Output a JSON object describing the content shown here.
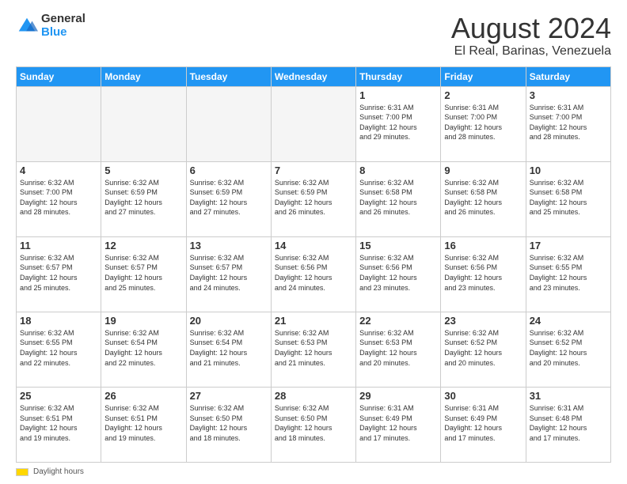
{
  "logo": {
    "general": "General",
    "blue": "Blue"
  },
  "title": "August 2024",
  "subtitle": "El Real, Barinas, Venezuela",
  "days_of_week": [
    "Sunday",
    "Monday",
    "Tuesday",
    "Wednesday",
    "Thursday",
    "Friday",
    "Saturday"
  ],
  "footer": {
    "daylight_label": "Daylight hours"
  },
  "weeks": [
    [
      {
        "day": "",
        "info": ""
      },
      {
        "day": "",
        "info": ""
      },
      {
        "day": "",
        "info": ""
      },
      {
        "day": "",
        "info": ""
      },
      {
        "day": "1",
        "info": "Sunrise: 6:31 AM\nSunset: 7:00 PM\nDaylight: 12 hours\nand 29 minutes."
      },
      {
        "day": "2",
        "info": "Sunrise: 6:31 AM\nSunset: 7:00 PM\nDaylight: 12 hours\nand 28 minutes."
      },
      {
        "day": "3",
        "info": "Sunrise: 6:31 AM\nSunset: 7:00 PM\nDaylight: 12 hours\nand 28 minutes."
      }
    ],
    [
      {
        "day": "4",
        "info": "Sunrise: 6:32 AM\nSunset: 7:00 PM\nDaylight: 12 hours\nand 28 minutes."
      },
      {
        "day": "5",
        "info": "Sunrise: 6:32 AM\nSunset: 6:59 PM\nDaylight: 12 hours\nand 27 minutes."
      },
      {
        "day": "6",
        "info": "Sunrise: 6:32 AM\nSunset: 6:59 PM\nDaylight: 12 hours\nand 27 minutes."
      },
      {
        "day": "7",
        "info": "Sunrise: 6:32 AM\nSunset: 6:59 PM\nDaylight: 12 hours\nand 26 minutes."
      },
      {
        "day": "8",
        "info": "Sunrise: 6:32 AM\nSunset: 6:58 PM\nDaylight: 12 hours\nand 26 minutes."
      },
      {
        "day": "9",
        "info": "Sunrise: 6:32 AM\nSunset: 6:58 PM\nDaylight: 12 hours\nand 26 minutes."
      },
      {
        "day": "10",
        "info": "Sunrise: 6:32 AM\nSunset: 6:58 PM\nDaylight: 12 hours\nand 25 minutes."
      }
    ],
    [
      {
        "day": "11",
        "info": "Sunrise: 6:32 AM\nSunset: 6:57 PM\nDaylight: 12 hours\nand 25 minutes."
      },
      {
        "day": "12",
        "info": "Sunrise: 6:32 AM\nSunset: 6:57 PM\nDaylight: 12 hours\nand 25 minutes."
      },
      {
        "day": "13",
        "info": "Sunrise: 6:32 AM\nSunset: 6:57 PM\nDaylight: 12 hours\nand 24 minutes."
      },
      {
        "day": "14",
        "info": "Sunrise: 6:32 AM\nSunset: 6:56 PM\nDaylight: 12 hours\nand 24 minutes."
      },
      {
        "day": "15",
        "info": "Sunrise: 6:32 AM\nSunset: 6:56 PM\nDaylight: 12 hours\nand 23 minutes."
      },
      {
        "day": "16",
        "info": "Sunrise: 6:32 AM\nSunset: 6:56 PM\nDaylight: 12 hours\nand 23 minutes."
      },
      {
        "day": "17",
        "info": "Sunrise: 6:32 AM\nSunset: 6:55 PM\nDaylight: 12 hours\nand 23 minutes."
      }
    ],
    [
      {
        "day": "18",
        "info": "Sunrise: 6:32 AM\nSunset: 6:55 PM\nDaylight: 12 hours\nand 22 minutes."
      },
      {
        "day": "19",
        "info": "Sunrise: 6:32 AM\nSunset: 6:54 PM\nDaylight: 12 hours\nand 22 minutes."
      },
      {
        "day": "20",
        "info": "Sunrise: 6:32 AM\nSunset: 6:54 PM\nDaylight: 12 hours\nand 21 minutes."
      },
      {
        "day": "21",
        "info": "Sunrise: 6:32 AM\nSunset: 6:53 PM\nDaylight: 12 hours\nand 21 minutes."
      },
      {
        "day": "22",
        "info": "Sunrise: 6:32 AM\nSunset: 6:53 PM\nDaylight: 12 hours\nand 20 minutes."
      },
      {
        "day": "23",
        "info": "Sunrise: 6:32 AM\nSunset: 6:52 PM\nDaylight: 12 hours\nand 20 minutes."
      },
      {
        "day": "24",
        "info": "Sunrise: 6:32 AM\nSunset: 6:52 PM\nDaylight: 12 hours\nand 20 minutes."
      }
    ],
    [
      {
        "day": "25",
        "info": "Sunrise: 6:32 AM\nSunset: 6:51 PM\nDaylight: 12 hours\nand 19 minutes."
      },
      {
        "day": "26",
        "info": "Sunrise: 6:32 AM\nSunset: 6:51 PM\nDaylight: 12 hours\nand 19 minutes."
      },
      {
        "day": "27",
        "info": "Sunrise: 6:32 AM\nSunset: 6:50 PM\nDaylight: 12 hours\nand 18 minutes."
      },
      {
        "day": "28",
        "info": "Sunrise: 6:32 AM\nSunset: 6:50 PM\nDaylight: 12 hours\nand 18 minutes."
      },
      {
        "day": "29",
        "info": "Sunrise: 6:31 AM\nSunset: 6:49 PM\nDaylight: 12 hours\nand 17 minutes."
      },
      {
        "day": "30",
        "info": "Sunrise: 6:31 AM\nSunset: 6:49 PM\nDaylight: 12 hours\nand 17 minutes."
      },
      {
        "day": "31",
        "info": "Sunrise: 6:31 AM\nSunset: 6:48 PM\nDaylight: 12 hours\nand 17 minutes."
      }
    ]
  ]
}
